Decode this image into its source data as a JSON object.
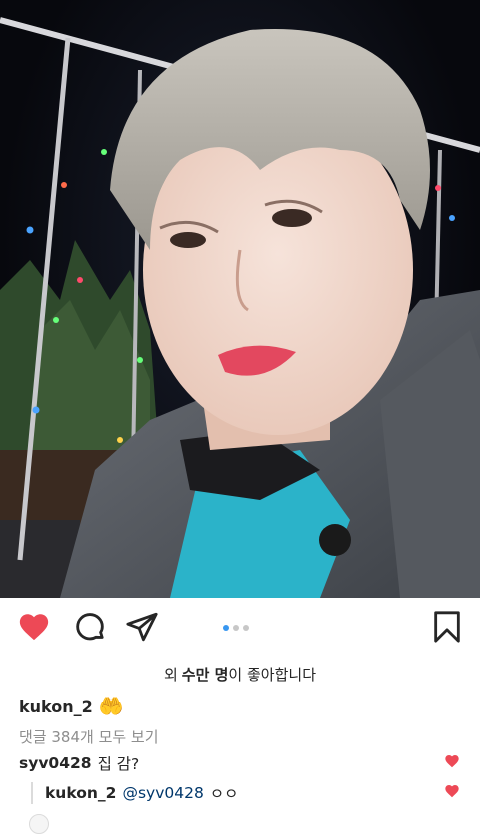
{
  "post": {
    "likes_prefix": "외",
    "likes_bold": "수만 명",
    "likes_suffix": "이 좋아합니다",
    "author": "kukon_2",
    "author_emoji": "🤲",
    "view_all_comments": "댓글 384개 모두 보기",
    "carousel": {
      "count": 3,
      "active_index": 0
    }
  },
  "comments": [
    {
      "user": "syv0428",
      "text": "집 감?"
    }
  ],
  "replies": [
    {
      "user": "kukon_2",
      "mention": "@syv0428",
      "text": "ㅇㅇ"
    }
  ],
  "colors": {
    "like_red": "#ed4956",
    "active_dot": "#3897f0",
    "mention_blue": "#00376b",
    "muted_text": "#8e8e8e"
  },
  "icons": {
    "like": "heart-filled-icon",
    "comment": "comment-bubble-icon",
    "share": "paper-plane-icon",
    "save": "bookmark-icon"
  }
}
